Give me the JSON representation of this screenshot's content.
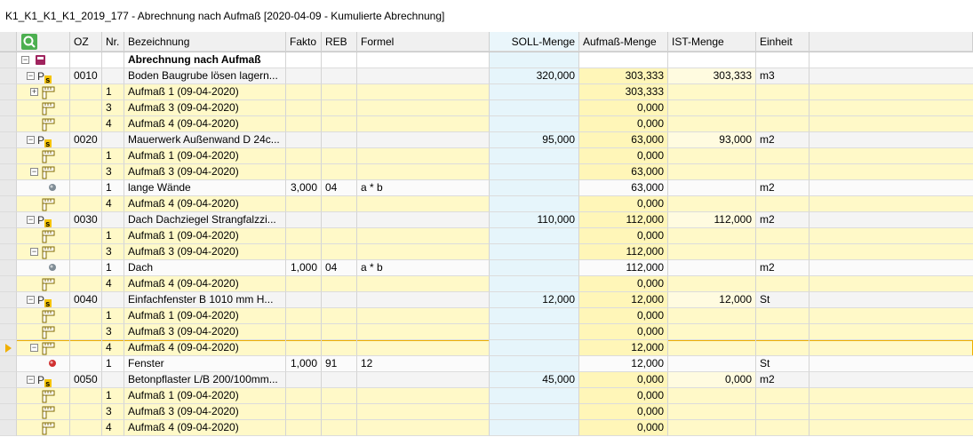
{
  "title": "K1_K1_K1_K1_2019_177 - Abrechnung nach Aufmaß [2020-04-09 - Kumulierte Abrechnung]",
  "columns": {
    "oz": "OZ",
    "nr": "Nr.",
    "bezeichnung": "Bezeichnung",
    "fakto": "Fakto",
    "reb": "REB",
    "formel": "Formel",
    "soll": "SOLL-Menge",
    "aufmass": "Aufmaß-Menge",
    "ist": "IST-Menge",
    "einheit": "Einheit"
  },
  "rows": [
    {
      "type": "root",
      "oz": "",
      "nr": "",
      "bez": "Abrechnung nach Aufmaß",
      "fakto": "",
      "reb": "",
      "formel": "",
      "soll": "",
      "auf": "",
      "ist": "",
      "ein": ""
    },
    {
      "type": "pos",
      "oz": "0010",
      "nr": "",
      "bez": "Boden Baugrube lösen lagern...",
      "fakto": "",
      "reb": "",
      "formel": "",
      "soll": "320,000",
      "auf": "303,333",
      "ist": "303,333",
      "ein": "m3"
    },
    {
      "type": "meas",
      "exp": "plus",
      "oz": "",
      "nr": "1",
      "bez": "Aufmaß 1 (09-04-2020)",
      "fakto": "",
      "reb": "",
      "formel": "",
      "soll": "",
      "auf": "303,333",
      "ist": "",
      "ein": ""
    },
    {
      "type": "meas",
      "oz": "",
      "nr": "3",
      "bez": "Aufmaß 3 (09-04-2020)",
      "fakto": "",
      "reb": "",
      "formel": "",
      "soll": "",
      "auf": "0,000",
      "ist": "",
      "ein": ""
    },
    {
      "type": "meas",
      "oz": "",
      "nr": "4",
      "bez": "Aufmaß 4 (09-04-2020)",
      "fakto": "",
      "reb": "",
      "formel": "",
      "soll": "",
      "auf": "0,000",
      "ist": "",
      "ein": ""
    },
    {
      "type": "pos",
      "oz": "0020",
      "nr": "",
      "bez": "Mauerwerk Außenwand D 24c...",
      "fakto": "",
      "reb": "",
      "formel": "",
      "soll": "95,000",
      "auf": "63,000",
      "ist": "93,000",
      "ein": "m2"
    },
    {
      "type": "meas",
      "oz": "",
      "nr": "1",
      "bez": "Aufmaß 1 (09-04-2020)",
      "fakto": "",
      "reb": "",
      "formel": "",
      "soll": "",
      "auf": "0,000",
      "ist": "",
      "ein": ""
    },
    {
      "type": "meas",
      "exp": "minus",
      "oz": "",
      "nr": "3",
      "bez": "Aufmaß 3 (09-04-2020)",
      "fakto": "",
      "reb": "",
      "formel": "",
      "soll": "",
      "auf": "63,000",
      "ist": "",
      "ein": ""
    },
    {
      "type": "det",
      "dot": "grey",
      "oz": "",
      "nr": "1",
      "bez": "lange Wände",
      "fakto": "3,000",
      "reb": "04",
      "formel": "a * b",
      "soll": "",
      "auf": "63,000",
      "ist": "",
      "ein": "m2"
    },
    {
      "type": "meas",
      "oz": "",
      "nr": "4",
      "bez": "Aufmaß 4 (09-04-2020)",
      "fakto": "",
      "reb": "",
      "formel": "",
      "soll": "",
      "auf": "0,000",
      "ist": "",
      "ein": ""
    },
    {
      "type": "pos",
      "oz": "0030",
      "nr": "",
      "bez": "Dach Dachziegel Strangfalzzi...",
      "fakto": "",
      "reb": "",
      "formel": "",
      "soll": "110,000",
      "auf": "112,000",
      "ist": "112,000",
      "ein": "m2"
    },
    {
      "type": "meas",
      "oz": "",
      "nr": "1",
      "bez": "Aufmaß 1 (09-04-2020)",
      "fakto": "",
      "reb": "",
      "formel": "",
      "soll": "",
      "auf": "0,000",
      "ist": "",
      "ein": ""
    },
    {
      "type": "meas",
      "exp": "minus",
      "oz": "",
      "nr": "3",
      "bez": "Aufmaß 3 (09-04-2020)",
      "fakto": "",
      "reb": "",
      "formel": "",
      "soll": "",
      "auf": "112,000",
      "ist": "",
      "ein": ""
    },
    {
      "type": "det",
      "dot": "grey",
      "oz": "",
      "nr": "1",
      "bez": "Dach",
      "fakto": "1,000",
      "reb": "04",
      "formel": "a * b",
      "soll": "",
      "auf": "112,000",
      "ist": "",
      "ein": "m2"
    },
    {
      "type": "meas",
      "oz": "",
      "nr": "4",
      "bez": "Aufmaß 4 (09-04-2020)",
      "fakto": "",
      "reb": "",
      "formel": "",
      "soll": "",
      "auf": "0,000",
      "ist": "",
      "ein": ""
    },
    {
      "type": "pos",
      "oz": "0040",
      "nr": "",
      "bez": "Einfachfenster B 1010 mm H...",
      "fakto": "",
      "reb": "",
      "formel": "",
      "soll": "12,000",
      "auf": "12,000",
      "ist": "12,000",
      "ein": "St"
    },
    {
      "type": "meas",
      "oz": "",
      "nr": "1",
      "bez": "Aufmaß 1 (09-04-2020)",
      "fakto": "",
      "reb": "",
      "formel": "",
      "soll": "",
      "auf": "0,000",
      "ist": "",
      "ein": ""
    },
    {
      "type": "meas",
      "oz": "",
      "nr": "3",
      "bez": "Aufmaß 3 (09-04-2020)",
      "fakto": "",
      "reb": "",
      "formel": "",
      "soll": "",
      "auf": "0,000",
      "ist": "",
      "ein": ""
    },
    {
      "type": "meas",
      "exp": "minus",
      "sel": true,
      "oz": "",
      "nr": "4",
      "bez": "Aufmaß 4 (09-04-2020)",
      "fakto": "",
      "reb": "",
      "formel": "",
      "soll": "",
      "auf": "12,000",
      "ist": "",
      "ein": ""
    },
    {
      "type": "det",
      "dot": "red",
      "oz": "",
      "nr": "1",
      "bez": "Fenster",
      "fakto": "1,000",
      "reb": "91",
      "formel": "12",
      "soll": "",
      "auf": "12,000",
      "ist": "",
      "ein": "St"
    },
    {
      "type": "pos",
      "oz": "0050",
      "nr": "",
      "bez": "Betonpflaster L/B 200/100mm...",
      "fakto": "",
      "reb": "",
      "formel": "",
      "soll": "45,000",
      "auf": "0,000",
      "ist": "0,000",
      "ein": "m2"
    },
    {
      "type": "meas",
      "oz": "",
      "nr": "1",
      "bez": "Aufmaß 1 (09-04-2020)",
      "fakto": "",
      "reb": "",
      "formel": "",
      "soll": "",
      "auf": "0,000",
      "ist": "",
      "ein": ""
    },
    {
      "type": "meas",
      "oz": "",
      "nr": "3",
      "bez": "Aufmaß 3 (09-04-2020)",
      "fakto": "",
      "reb": "",
      "formel": "",
      "soll": "",
      "auf": "0,000",
      "ist": "",
      "ein": ""
    },
    {
      "type": "meas",
      "oz": "",
      "nr": "4",
      "bez": "Aufmaß 4 (09-04-2020)",
      "fakto": "",
      "reb": "",
      "formel": "",
      "soll": "",
      "auf": "0,000",
      "ist": "",
      "ein": ""
    }
  ]
}
